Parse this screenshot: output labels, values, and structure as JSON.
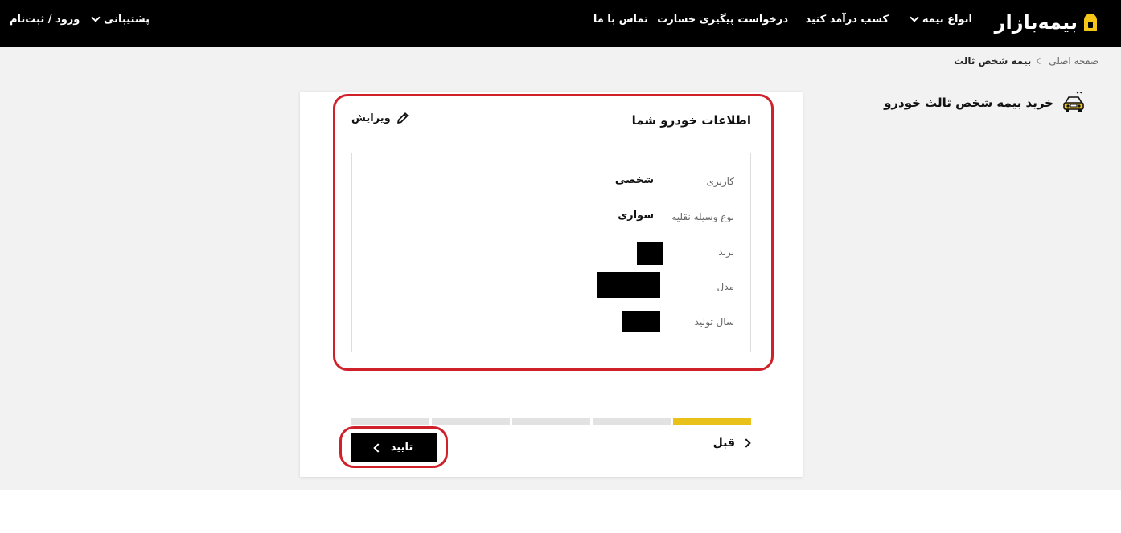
{
  "header": {
    "logo_text": "بیمه‌بازار",
    "nav": {
      "insurance_types": "انواع بیمه",
      "earn_income": "کسب درآمد کنید",
      "claim_followup": "درخواست پیگیری خسارت",
      "contact_us": "تماس با ما",
      "support": "پشتیبانی",
      "login": "ورود / ثبت‌نام"
    }
  },
  "breadcrumb": {
    "home": "صفحه اصلی",
    "current": "بیمه شخص ثالث"
  },
  "page_title": "خرید بیمه شخص ثالث خودرو",
  "card": {
    "title": "اطلاعات خودرو شما",
    "edit_label": "ویرایش",
    "rows": [
      {
        "label": "کاربری",
        "value": "شخصی"
      },
      {
        "label": "نوع وسیله نقلیه",
        "value": "سواری"
      },
      {
        "label": "برند",
        "value": ""
      },
      {
        "label": "مدل",
        "value": ""
      },
      {
        "label": "سال تولید",
        "value": ""
      }
    ],
    "progress": {
      "total_steps": 5,
      "current_step": 1
    },
    "prev_label": "قبل",
    "confirm_label": "تایید"
  },
  "colors": {
    "accent": "#e8c21a",
    "highlight": "#d0202a",
    "header_bg": "#000000"
  }
}
